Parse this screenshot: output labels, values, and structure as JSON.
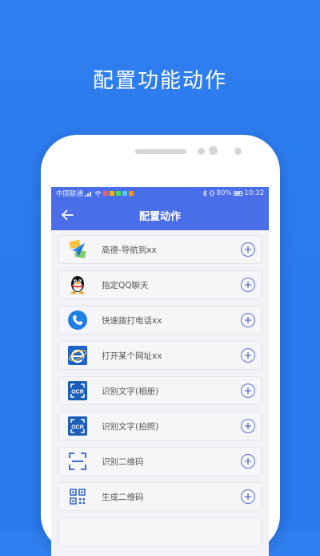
{
  "promo": {
    "title": "配置功能动作"
  },
  "status_bar": {
    "carrier": "中国联通",
    "battery": "80%",
    "time": "10:32"
  },
  "app_bar": {
    "title": "配置动作"
  },
  "actions": [
    {
      "label": "高德-导航到xx",
      "icon": "amap-navigation-icon"
    },
    {
      "label": "指定QQ聊天",
      "icon": "qq-penguin-icon"
    },
    {
      "label": "快速拨打电话xx",
      "icon": "phone-icon"
    },
    {
      "label": "打开某个网址xx",
      "icon": "browser-ie-icon"
    },
    {
      "label": "识别文字(相册)",
      "icon": "ocr-icon"
    },
    {
      "label": "识别文字(拍照)",
      "icon": "ocr-icon"
    },
    {
      "label": "识别二维码",
      "icon": "scan-icon"
    },
    {
      "label": "生成二维码",
      "icon": "qrcode-icon"
    }
  ],
  "colors": {
    "background": "#2a79ee",
    "primary": "#4a6de8",
    "add": "#5b6fd0"
  }
}
